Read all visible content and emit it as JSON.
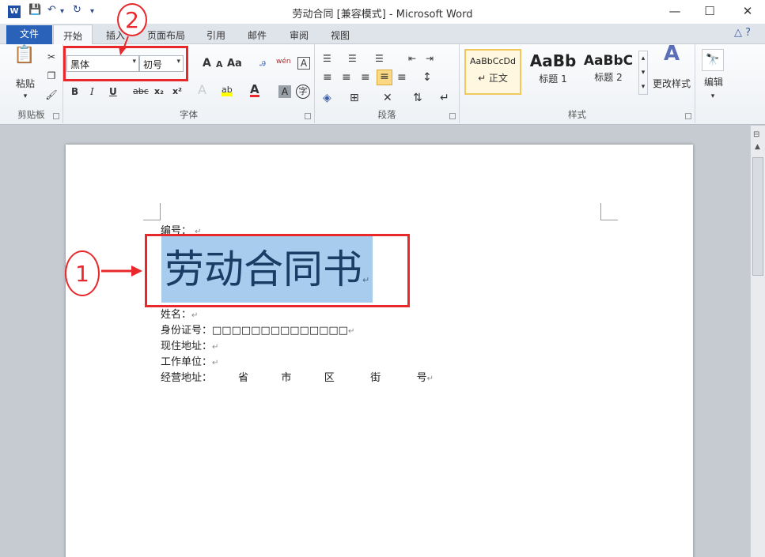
{
  "window": {
    "title": "劳动合同 [兼容模式] - Microsoft Word",
    "app_icon": "W",
    "minimize_icon": "—",
    "maximize_icon": "☐",
    "close_icon": "✕"
  },
  "quick_access": {
    "save_icon": "💾",
    "undo_icon": "↶",
    "undo_dropdown": "▾",
    "redo_icon": "↻",
    "customize": "▾"
  },
  "tabs": {
    "file": "文件",
    "items": [
      "开始",
      "插入",
      "页面布局",
      "引用",
      "邮件",
      "审阅",
      "视图"
    ],
    "active": "开始",
    "help_icons": "△ ?"
  },
  "clipboard": {
    "paste_label": "粘贴",
    "paste_arrow": "▾",
    "cut_icon": "✂",
    "copy_icon": "❐",
    "format_painter_icon": "🖌",
    "group_label": "剪贴板"
  },
  "font": {
    "font_name": "黑体",
    "font_size": "初号",
    "grow": "A",
    "shrink": "A",
    "change_case": "Aa",
    "clear_format": "ꭿ",
    "phonetic": "wén",
    "border": "A",
    "bold": "B",
    "italic": "I",
    "underline": "U",
    "strikethrough": "abc",
    "subscript": "x₂",
    "superscript": "x²",
    "text_effect": "A",
    "highlight": "ab",
    "font_color": "A",
    "shading": "A",
    "enclosed": "字",
    "group_label": "字体"
  },
  "paragraph": {
    "bullets": "☰",
    "numbering": "☰",
    "multilevel": "☰",
    "decrease_indent": "⇤",
    "increase_indent": "⇥",
    "align_left": "≡",
    "center": "≡",
    "align_right": "≡",
    "justify": "≡",
    "distributed": "≡",
    "line_spacing": "↕",
    "shading": "◈",
    "borders": "⊞",
    "sort": "⇅",
    "chinese_layout": "✕",
    "show_marks": "↵",
    "group_label": "段落"
  },
  "styles": {
    "items": [
      {
        "sample": "AaBbCcDd",
        "name": "↵ 正文"
      },
      {
        "sample": "AaBb",
        "name": "标题 1"
      },
      {
        "sample": "AaBbC",
        "name": "标题 2"
      }
    ],
    "change_styles": "更改样式",
    "group_label": "样式"
  },
  "editing": {
    "label": "编辑",
    "icon": "🔭"
  },
  "document": {
    "number_line": "编号：",
    "heading": "劳动合同书",
    "lines": [
      "姓名：",
      "身份证号：□□□□□□□□□□□□□□",
      "现住地址：",
      "工作单位：",
      "经营地址：        省          市          区           街           号"
    ],
    "paragraph_mark": "↵"
  },
  "annotations": {
    "callout_1": "1",
    "callout_2": "2"
  }
}
